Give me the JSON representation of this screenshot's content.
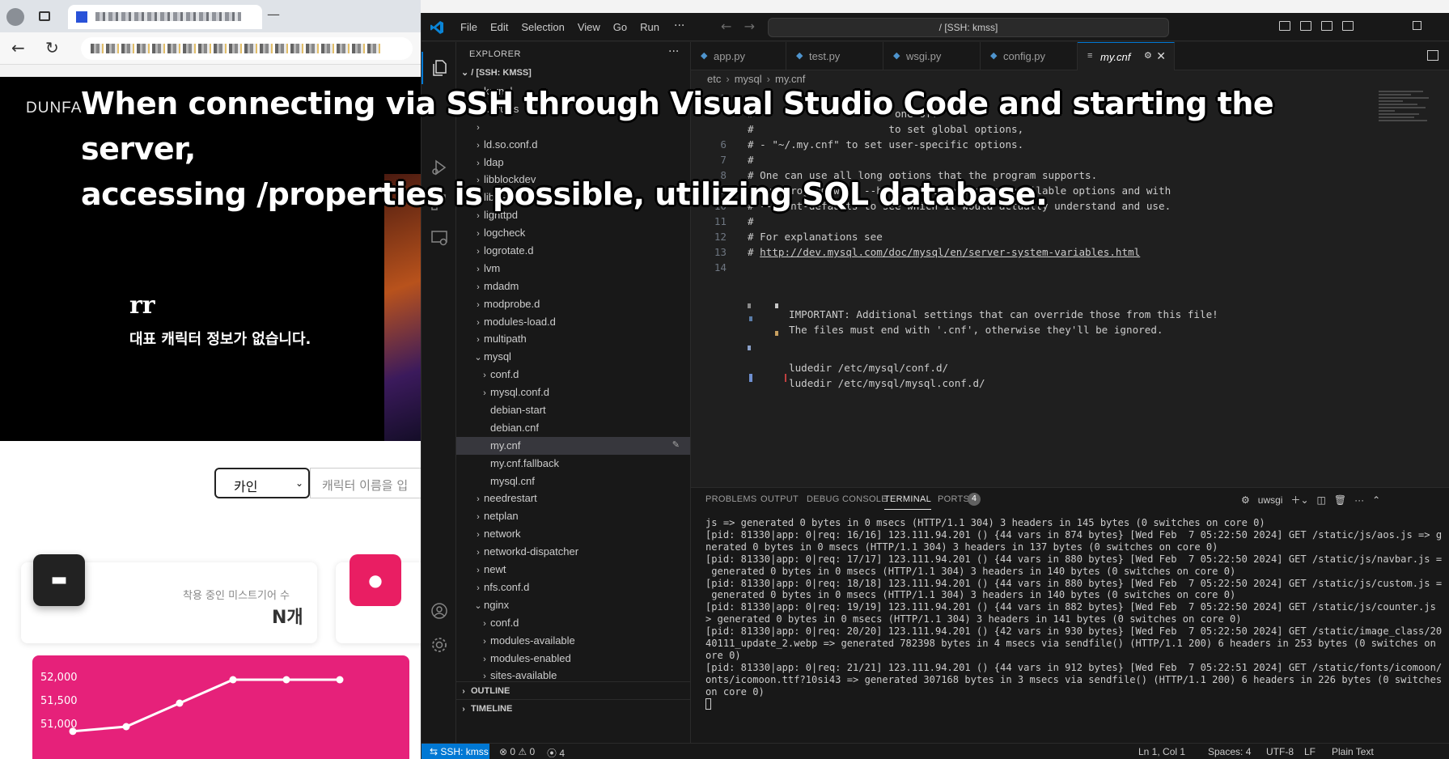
{
  "browser": {
    "site_brand": "DUNFA",
    "character_name": "rr",
    "no_character_msg": "대표 캐릭터 정보가 없습니다.",
    "server_select": "카인",
    "search_placeholder": "캐릭터 이름을 입",
    "card_label": "착용 중인 미스트기어 수",
    "card_value": "N개",
    "chart": {
      "type": "line",
      "y_ticks": [
        "52,000",
        "51,500",
        "51,000"
      ],
      "values": [
        50900,
        51000,
        51500,
        52000,
        52000,
        52000
      ]
    }
  },
  "vscode": {
    "menu": [
      "File",
      "Edit",
      "Selection",
      "View",
      "Go",
      "Run",
      "···"
    ],
    "command_center": "/ [SSH: kmss]",
    "explorer_title": "EXPLORER",
    "explorer_root": "/ [SSH: KMSS]",
    "tree": [
      {
        "label": "kernel",
        "type": "folder",
        "depth": 0,
        "open": false
      },
      {
        "label": "keyutils",
        "type": "folder",
        "depth": 0,
        "open": false
      },
      {
        "label": "",
        "type": "folder",
        "depth": 0,
        "open": false
      },
      {
        "label": "ld.so.conf.d",
        "type": "folder",
        "depth": 0,
        "open": false
      },
      {
        "label": "ldap",
        "type": "folder",
        "depth": 0,
        "open": false
      },
      {
        "label": "libblockdev",
        "type": "folder",
        "depth": 0,
        "open": false
      },
      {
        "label": "libnl-3",
        "type": "folder",
        "depth": 0,
        "open": false
      },
      {
        "label": "lighttpd",
        "type": "folder",
        "depth": 0,
        "open": false
      },
      {
        "label": "logcheck",
        "type": "folder",
        "depth": 0,
        "open": false
      },
      {
        "label": "logrotate.d",
        "type": "folder",
        "depth": 0,
        "open": false
      },
      {
        "label": "lvm",
        "type": "folder",
        "depth": 0,
        "open": false
      },
      {
        "label": "mdadm",
        "type": "folder",
        "depth": 0,
        "open": false
      },
      {
        "label": "modprobe.d",
        "type": "folder",
        "depth": 0,
        "open": false
      },
      {
        "label": "modules-load.d",
        "type": "folder",
        "depth": 0,
        "open": false
      },
      {
        "label": "multipath",
        "type": "folder",
        "depth": 0,
        "open": false
      },
      {
        "label": "mysql",
        "type": "folder",
        "depth": 0,
        "open": true
      },
      {
        "label": "conf.d",
        "type": "folder",
        "depth": 1,
        "open": false
      },
      {
        "label": "mysql.conf.d",
        "type": "folder",
        "depth": 1,
        "open": false
      },
      {
        "label": "debian-start",
        "type": "file",
        "depth": 1
      },
      {
        "label": "debian.cnf",
        "type": "file",
        "depth": 1
      },
      {
        "label": "my.cnf",
        "type": "file",
        "depth": 1,
        "selected": true
      },
      {
        "label": "my.cnf.fallback",
        "type": "file",
        "depth": 1
      },
      {
        "label": "mysql.cnf",
        "type": "file",
        "depth": 1
      },
      {
        "label": "needrestart",
        "type": "folder",
        "depth": 0,
        "open": false
      },
      {
        "label": "netplan",
        "type": "folder",
        "depth": 0,
        "open": false
      },
      {
        "label": "network",
        "type": "folder",
        "depth": 0,
        "open": false
      },
      {
        "label": "networkd-dispatcher",
        "type": "folder",
        "depth": 0,
        "open": false
      },
      {
        "label": "newt",
        "type": "folder",
        "depth": 0,
        "open": false
      },
      {
        "label": "nfs.conf.d",
        "type": "folder",
        "depth": 0,
        "open": false
      },
      {
        "label": "nginx",
        "type": "folder",
        "depth": 0,
        "open": true
      },
      {
        "label": "conf.d",
        "type": "folder",
        "depth": 1,
        "open": false
      },
      {
        "label": "modules-available",
        "type": "folder",
        "depth": 1,
        "open": false
      },
      {
        "label": "modules-enabled",
        "type": "folder",
        "depth": 1,
        "open": false
      },
      {
        "label": "sites-available",
        "type": "folder",
        "depth": 1,
        "open": false
      }
    ],
    "outline_label": "OUTLINE",
    "timeline_label": "TIMELINE",
    "tabs": [
      {
        "label": "app.py"
      },
      {
        "label": "test.py"
      },
      {
        "label": "wsgi.py"
      },
      {
        "label": "config.py"
      },
      {
        "label": "my.cnf",
        "active": true
      }
    ],
    "breadcrumb": [
      "etc",
      "mysql",
      "my.cnf"
    ],
    "code_lines": [
      {
        "n": "3",
        "t": "#"
      },
      {
        "n": "",
        "t": "#                       one of:"
      },
      {
        "n": "",
        "t": "#                      to set global options,"
      },
      {
        "n": "6",
        "t": "# - \"~/.my.cnf\" to set user-specific options."
      },
      {
        "n": "7",
        "t": "#"
      },
      {
        "n": "8",
        "t": "# One can use all long options that the program supports."
      },
      {
        "n": "9",
        "t": "# Run program with --help to get a list of available options and with"
      },
      {
        "n": "10",
        "t": "# --print-defaults to see which it would actually understand and use."
      },
      {
        "n": "11",
        "t": "#"
      },
      {
        "n": "12",
        "t": "# For explanations see"
      },
      {
        "n": "13",
        "t": "# http://dev.mysql.com/doc/mysql/en/server-system-variables.html"
      },
      {
        "n": "14",
        "t": ""
      }
    ],
    "code_tail": [
      "IMPORTANT: Additional settings that can override those from this file!",
      "The files must end with '.cnf', otherwise they'll be ignored.",
      "ludedir /etc/mysql/conf.d/",
      "ludedir /etc/mysql/mysql.conf.d/"
    ],
    "panel_tabs": [
      "PROBLEMS",
      "OUTPUT",
      "DEBUG CONSOLE",
      "TERMINAL",
      "PORTS"
    ],
    "ports_count": "4",
    "terminal_name": "uwsgi",
    "terminal_lines": [
      "js => generated 0 bytes in 0 msecs (HTTP/1.1 304) 3 headers in 145 bytes (0 switches on core 0)",
      "[pid: 81330|app: 0|req: 16/16] 123.111.94.201 () {44 vars in 874 bytes} [Wed Feb  7 05:22:50 2024] GET /static/js/aos.js => ge",
      "nerated 0 bytes in 0 msecs (HTTP/1.1 304) 3 headers in 137 bytes (0 switches on core 0)",
      "[pid: 81330|app: 0|req: 17/17] 123.111.94.201 () {44 vars in 880 bytes} [Wed Feb  7 05:22:50 2024] GET /static/js/navbar.js =>",
      " generated 0 bytes in 0 msecs (HTTP/1.1 304) 3 headers in 140 bytes (0 switches on core 0)",
      "[pid: 81330|app: 0|req: 18/18] 123.111.94.201 () {44 vars in 880 bytes} [Wed Feb  7 05:22:50 2024] GET /static/js/custom.js =>",
      " generated 0 bytes in 0 msecs (HTTP/1.1 304) 3 headers in 140 bytes (0 switches on core 0)",
      "[pid: 81330|app: 0|req: 19/19] 123.111.94.201 () {44 vars in 882 bytes} [Wed Feb  7 05:22:50 2024] GET /static/js/counter.js =",
      "> generated 0 bytes in 0 msecs (HTTP/1.1 304) 3 headers in 141 bytes (0 switches on core 0)",
      "[pid: 81330|app: 0|req: 20/20] 123.111.94.201 () {42 vars in 930 bytes} [Wed Feb  7 05:22:50 2024] GET /static/image_class/20",
      "40111_update_2.webp => generated 782398 bytes in 4 msecs via sendfile() (HTTP/1.1 200) 6 headers in 253 bytes (0 switches on c",
      "ore 0)",
      "[pid: 81330|app: 0|req: 21/21] 123.111.94.201 () {44 vars in 912 bytes} [Wed Feb  7 05:22:51 2024] GET /static/fonts/icomoon/f",
      "onts/icomoon.ttf?10si43 => generated 307168 bytes in 3 msecs via sendfile() (HTTP/1.1 200) 6 headers in 226 bytes (0 switches",
      "on core 0)"
    ],
    "status": {
      "remote": "SSH: kmss",
      "problems": "⊗ 0 ⚠ 0",
      "ports": "4",
      "position": "Ln 1, Col 1",
      "spaces": "Spaces: 4",
      "encoding": "UTF-8",
      "eol": "LF",
      "language": "Plain Text"
    }
  },
  "caption": {
    "line1": "When connecting via SSH through Visual Studio Code and starting the server,",
    "line2": "accessing /properties is possible, utilizing SQL database."
  }
}
